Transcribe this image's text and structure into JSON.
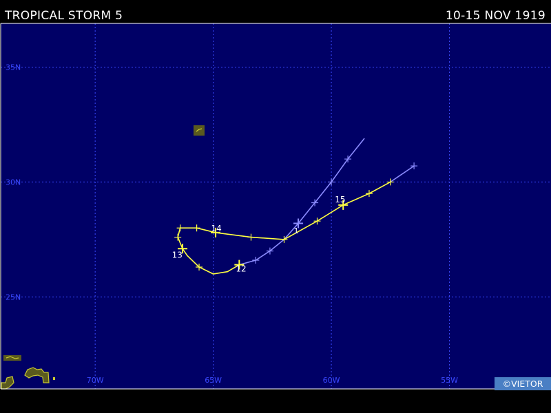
{
  "header": {
    "title": "TROPICAL STORM 5",
    "date_range": "10-15 NOV 1919"
  },
  "credit": "©VIETOR",
  "map": {
    "lon_range": [
      -74,
      -50.7
    ],
    "lat_range": [
      21.0,
      36.9
    ],
    "lat_labels": [
      {
        "lat": 35,
        "label": "35N"
      },
      {
        "lat": 30,
        "label": "30N"
      },
      {
        "lat": 25,
        "label": "25N"
      }
    ],
    "lon_labels": [
      {
        "lon": -70,
        "label": "70W"
      },
      {
        "lon": -65,
        "label": "65W"
      },
      {
        "lon": -60,
        "label": "60W"
      },
      {
        "lon": -55,
        "label": "55W"
      }
    ],
    "grid": true,
    "colors": {
      "ocean": "#000066",
      "grid": "#3a48ff",
      "land_fill": "#5a5a1e",
      "land_edge": "#c8c832",
      "track_storm": "#ffff40",
      "track_other": "#8c8cff"
    }
  },
  "track": {
    "day_labels": [
      {
        "label": "12",
        "lon": -63.9,
        "lat": 26.4
      },
      {
        "label": "13",
        "lon": -66.4,
        "lat": 27.0
      },
      {
        "lon": -64.8,
        "lat": 27.8,
        "label": "14"
      },
      {
        "lon": -59.5,
        "lat": 29.0,
        "label": "15"
      }
    ],
    "storm_segment": [
      {
        "lon": -63.9,
        "lat": 26.4,
        "marker": "day"
      },
      {
        "lon": -64.4,
        "lat": 26.1
      },
      {
        "lon": -65.0,
        "lat": 26.0
      },
      {
        "lon": -65.6,
        "lat": 26.3,
        "marker": "tick"
      },
      {
        "lon": -66.1,
        "lat": 26.8
      },
      {
        "lon": -66.3,
        "lat": 27.1,
        "marker": "day"
      },
      {
        "lon": -66.5,
        "lat": 27.6,
        "marker": "tick"
      },
      {
        "lon": -66.4,
        "lat": 28.0,
        "marker": "tick"
      },
      {
        "lon": -65.7,
        "lat": 28.0,
        "marker": "tick"
      },
      {
        "lon": -64.9,
        "lat": 27.8,
        "marker": "day"
      },
      {
        "lon": -63.4,
        "lat": 27.6,
        "marker": "tick"
      },
      {
        "lon": -62.0,
        "lat": 27.5,
        "marker": "tick"
      },
      {
        "lon": -60.6,
        "lat": 28.3,
        "marker": "tick"
      },
      {
        "lon": -59.5,
        "lat": 29.0,
        "marker": "day"
      },
      {
        "lon": -58.4,
        "lat": 29.5,
        "marker": "tick"
      },
      {
        "lon": -57.5,
        "lat": 30.0,
        "marker": "tick"
      }
    ],
    "other_segment_a": [
      {
        "lon": -63.9,
        "lat": 26.4
      },
      {
        "lon": -63.2,
        "lat": 26.6,
        "marker": "tick"
      },
      {
        "lon": -62.6,
        "lat": 27.0,
        "marker": "tick"
      },
      {
        "lon": -62.0,
        "lat": 27.5
      },
      {
        "lon": -61.4,
        "lat": 28.2,
        "marker": "day"
      },
      {
        "lon": -60.7,
        "lat": 29.1,
        "marker": "tick"
      },
      {
        "lon": -60.0,
        "lat": 30.0,
        "marker": "tick"
      },
      {
        "lon": -59.3,
        "lat": 31.0,
        "marker": "tick"
      },
      {
        "lon": -58.6,
        "lat": 31.9
      }
    ],
    "other_segment_b": [
      {
        "lon": -57.5,
        "lat": 30.0
      },
      {
        "lon": -56.5,
        "lat": 30.7,
        "marker": "tick"
      }
    ],
    "extra_label": {
      "label": "1",
      "lon": -61.5,
      "lat": 28.0
    }
  }
}
